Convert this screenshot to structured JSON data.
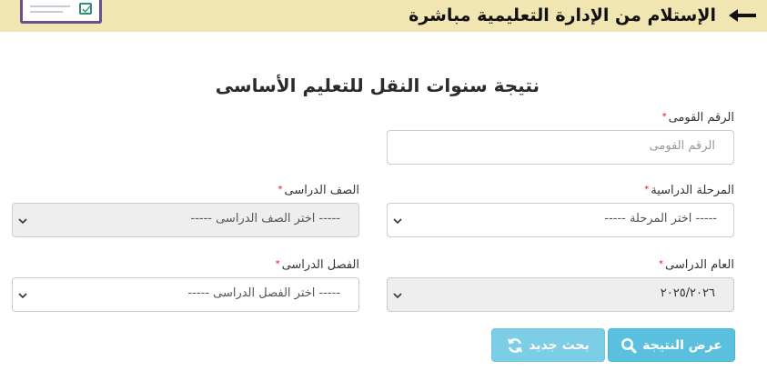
{
  "banner": {
    "title": "الإستلام من الإدارة التعليمية مباشرة",
    "arrow_icon": "arrow-left-icon",
    "logo_icon": "checklist-logo-icon",
    "bg_color": "#f1e6b2"
  },
  "form": {
    "title": "نتيجة سنوات النقل للتعليم الأساسى",
    "national_id": {
      "label": "الرقم القومى",
      "placeholder": "الرقم القومى",
      "value": ""
    },
    "stage": {
      "label": "المرحلة الدراسية",
      "selected": "----- اختر المرحلة -----"
    },
    "grade": {
      "label": "الصف الدراسى",
      "selected": "----- اختر الصف الدراسى -----"
    },
    "year": {
      "label": "العام الدراسى",
      "selected": "٢٠٢٥/٢٠٢٦"
    },
    "class": {
      "label": "الفصل الدراسى",
      "selected": "----- اختر الفصل الدراسى -----"
    },
    "required_mark": "*"
  },
  "buttons": {
    "show_result": {
      "label": "عرض النتيجة",
      "icon": "search-icon"
    },
    "new_search": {
      "label": "بحث جديد",
      "icon": "refresh-icon"
    }
  },
  "colors": {
    "button": "#5bc0de",
    "required": "#dd1111"
  }
}
